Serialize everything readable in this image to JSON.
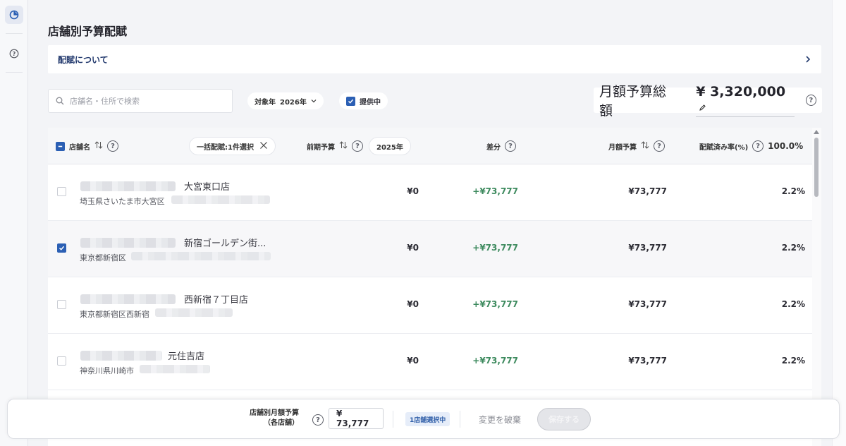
{
  "page": {
    "title": "店舗別予算配賦",
    "about_label": "配賦について"
  },
  "filters": {
    "search_placeholder": "店舗名・住所で検索",
    "year_label": "対象年",
    "year_value": "2026年",
    "provided_label": "提供中",
    "provided_checked": true
  },
  "total": {
    "label": "月額予算総額",
    "value": "¥ 3,320,000"
  },
  "table": {
    "headers": {
      "store": "店舗名",
      "bulk": "一括配賦:1件選択",
      "prev_budget": "前期予算",
      "prev_year": "2025年",
      "diff": "差分",
      "monthly": "月額予算",
      "rate": "配賦済み率(%)",
      "rate_total": "100.0%"
    },
    "rows": [
      {
        "name": "大宮東口店",
        "address": "埼玉県さいたま市大宮区",
        "prev": "¥0",
        "diff": "+¥73,777",
        "monthly": "¥73,777",
        "rate": "2.2%",
        "checked": false
      },
      {
        "name": "新宿ゴールデン街...",
        "address": "東京都新宿区",
        "prev": "¥0",
        "diff": "+¥73,777",
        "monthly": "¥73,777",
        "rate": "2.2%",
        "checked": true
      },
      {
        "name": "西新宿７丁目店",
        "address": "東京都新宿区西新宿",
        "prev": "¥0",
        "diff": "+¥73,777",
        "monthly": "¥73,777",
        "rate": "2.2%",
        "checked": false
      },
      {
        "name": "元住吉店",
        "address": "神奈川県川崎市",
        "prev": "¥0",
        "diff": "+¥73,777",
        "monthly": "¥73,777",
        "rate": "2.2%",
        "checked": false
      }
    ]
  },
  "bottom_bar": {
    "label_line1": "店舗別月額予算",
    "label_line2": "（各店舗）",
    "input_value": "¥ 73,777",
    "selected_badge": "1店舗選択中",
    "discard_label": "変更を破棄",
    "save_label": "保存する"
  },
  "colors": {
    "accent": "#2b5fb4",
    "positive": "#3d8a5e",
    "link": "#233a6e"
  },
  "icons": {
    "sidebar_active": "pie-chart-icon",
    "sidebar_help": "help-circle-icon",
    "search": "search-icon",
    "sort": "sort-icon",
    "close": "close-icon",
    "edit": "pencil-icon",
    "chevron": "chevron-right-icon"
  }
}
